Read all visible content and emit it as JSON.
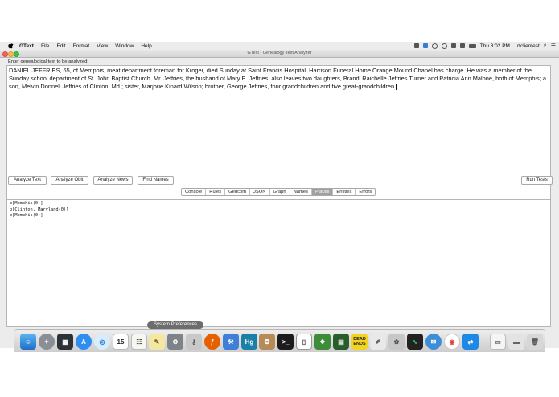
{
  "menubar": {
    "app_name": "GText",
    "items": [
      "File",
      "Edit",
      "Format",
      "View",
      "Window",
      "Help"
    ],
    "clock": "Thu 3:02 PM",
    "user": "rtclientest"
  },
  "window": {
    "title": "GText - Genealogy Text Analyzer"
  },
  "input": {
    "prompt": "Enter genealogical text to be analyzed:",
    "text": "DANIEL JEFFRIES, 65, of Memphis, meat department foreman for Kroger, died Sunday at Saint Francis Hospital. Harrison Funeral Home Orange Mound Chapel has charge. He was a member of the Sunday school department of St. John Baptist Church. Mr. Jeffries, the husband of Mary E. Jeffries, also leaves two daughters, Brandi Raichelle Jeffries Turner and Patricia Ann Malone, both of Memphis; a son, Melvin Donnell Jeffries of Clinton, Md.; sister, Marjorie Kinard Wilson; brother, George Jeffries, four grandchildren and five great-grandchildren."
  },
  "buttons": {
    "analyze_text": "Analyze Text",
    "analyze_obit": "Analyze Obit",
    "analyze_news": "Analyze News",
    "find_names": "Find Names",
    "run_tests": "Run Tests"
  },
  "tabs": [
    {
      "label": "Console"
    },
    {
      "label": "Rules"
    },
    {
      "label": "Gedcom"
    },
    {
      "label": "JSON"
    },
    {
      "label": "Graph"
    },
    {
      "label": "Names"
    },
    {
      "label": "Places",
      "active": true
    },
    {
      "label": "Entities"
    },
    {
      "label": "Errors"
    }
  ],
  "output": {
    "lines": [
      "p[Memphis(0)]",
      "p[Clinton, Maryland(0)]",
      "p[Memphis(0)]"
    ]
  },
  "dock": {
    "tooltip": "System Preferences",
    "calendar_day": "15",
    "dead_ends_label": "DEAD\nENDS",
    "hg_label": "Hg"
  }
}
